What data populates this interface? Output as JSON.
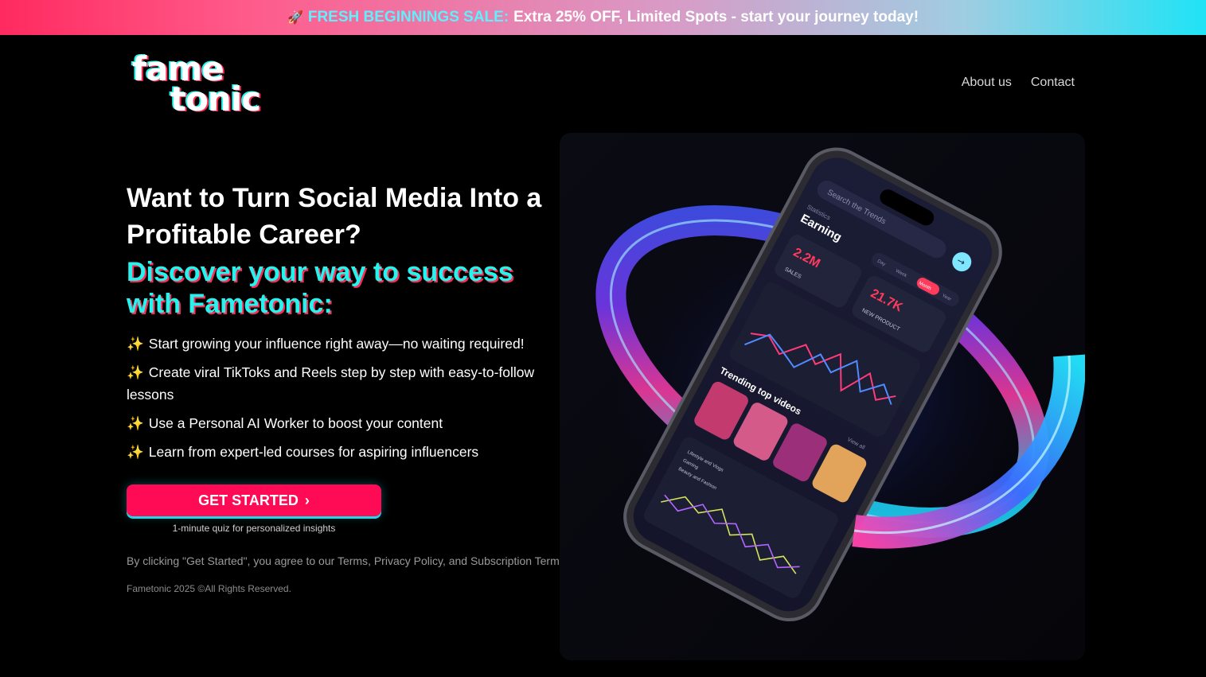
{
  "banner": {
    "icon": "rocket-icon",
    "sale_label": "FRESH BEGINNINGS SALE:",
    "message": "Extra 25% OFF, Limited Spots - start your journey today!"
  },
  "brand": {
    "line1": "fame",
    "line2": "tonic"
  },
  "nav": {
    "about": "About us",
    "contact": "Contact"
  },
  "hero": {
    "title": "Want to Turn Social Media Into a Profitable Career?",
    "subtitle": "Discover your way to success with Fametonic:",
    "bullet_icon": "✨",
    "bullets": [
      "Start growing your influence right away—no waiting required!",
      "Create viral TikToks and Reels step by step with easy-to-follow lessons",
      "Use a Personal AI Worker to boost your content",
      "Learn from expert-led courses for aspiring influencers"
    ]
  },
  "cta": {
    "label": "GET STARTED",
    "sub": "1-minute quiz for personalized insights"
  },
  "legal": {
    "prefix": "By clicking \"Get Started\", you agree to our",
    "terms": "Terms",
    "privacy": "Privacy Policy",
    "and": ", and",
    "subscription": "Subscription Terms"
  },
  "copyright": "Fametonic 2025 ©All Rights Reserved.",
  "phone": {
    "search": "Search the Trends",
    "stats_label": "Statistics",
    "earning": "Earning",
    "stat1_value": "2.2M",
    "stat1_label": "SALES",
    "stat2_value": "21.7K",
    "stat2_label": "NEW PRODUCT",
    "filters": [
      "Day",
      "Week",
      "Month",
      "Year"
    ],
    "trending": "Trending top videos",
    "view_all": "View all",
    "lifestyle_items": [
      "Lifestyle and Vlogs",
      "Gaming",
      "Beauty and Fashion"
    ]
  },
  "colors": {
    "cyan": "#25f4ee",
    "pink": "#fe2c55",
    "cta": "#ff0a54"
  }
}
